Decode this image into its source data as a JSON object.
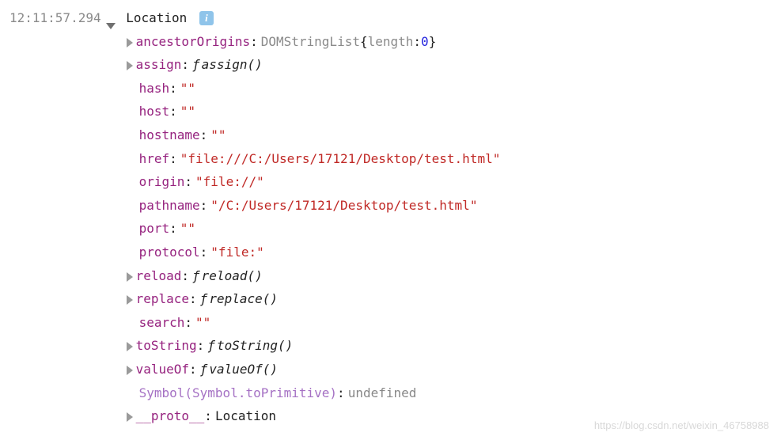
{
  "timestamp": "12:11:57.294",
  "root": {
    "name": "Location",
    "info_glyph": "i"
  },
  "props": [
    {
      "expandable": true,
      "key": "ancestorOrigins",
      "type": "objheader",
      "typeName": "DOMStringList",
      "inner_key": "length",
      "inner_val": "0"
    },
    {
      "expandable": true,
      "key": "assign",
      "type": "func",
      "funcName": "assign()"
    },
    {
      "expandable": false,
      "key": "hash",
      "type": "string",
      "value": "\"\""
    },
    {
      "expandable": false,
      "key": "host",
      "type": "string",
      "value": "\"\""
    },
    {
      "expandable": false,
      "key": "hostname",
      "type": "string",
      "value": "\"\""
    },
    {
      "expandable": false,
      "key": "href",
      "type": "string",
      "value": "\"file:///C:/Users/17121/Desktop/test.html\""
    },
    {
      "expandable": false,
      "key": "origin",
      "type": "string",
      "value": "\"file://\""
    },
    {
      "expandable": false,
      "key": "pathname",
      "type": "string",
      "value": "\"/C:/Users/17121/Desktop/test.html\""
    },
    {
      "expandable": false,
      "key": "port",
      "type": "string",
      "value": "\"\""
    },
    {
      "expandable": false,
      "key": "protocol",
      "type": "string",
      "value": "\"file:\""
    },
    {
      "expandable": true,
      "key": "reload",
      "type": "func",
      "funcName": "reload()"
    },
    {
      "expandable": true,
      "key": "replace",
      "type": "func",
      "funcName": "replace()"
    },
    {
      "expandable": false,
      "key": "search",
      "type": "string",
      "value": "\"\""
    },
    {
      "expandable": true,
      "key": "toString",
      "type": "func",
      "funcName": "toString()"
    },
    {
      "expandable": true,
      "key": "valueOf",
      "type": "func",
      "funcName": "valueOf()"
    },
    {
      "expandable": false,
      "key": "Symbol(Symbol.toPrimitive)",
      "type": "symbol_undef",
      "value": "undefined"
    },
    {
      "expandable": true,
      "key": "__proto__",
      "type": "obj",
      "value": "Location"
    }
  ],
  "watermark": "https://blog.csdn.net/weixin_46758988"
}
